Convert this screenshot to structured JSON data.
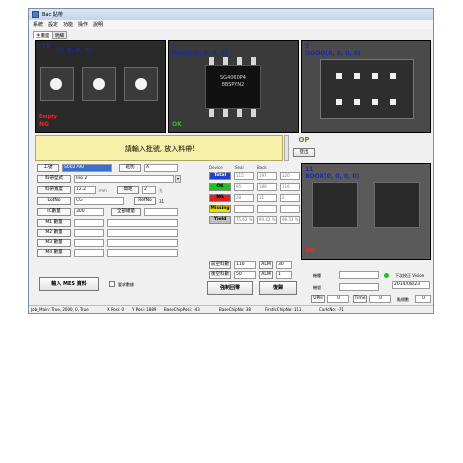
{
  "window": {
    "title": "Bac 貼帶"
  },
  "menu": [
    "系統",
    "設定",
    "功能",
    "操作",
    "說明"
  ],
  "tabs": [
    "主畫面",
    "明細"
  ],
  "cameras": [
    {
      "label": "-11",
      "coords": "(0, 0, 0, 0)",
      "status_top": "Empty",
      "status_bottom": "NG",
      "status_color": "#ff2020"
    },
    {
      "label": "5",
      "coords": "OOOO(0, 0, 0, 0)",
      "status_bottom": "OK",
      "status_color": "#20c020",
      "chip_text": "SG4060P4 8BSPYN2"
    },
    {
      "label": "3",
      "coords": "OOOO(0, 0, 0, 0)"
    },
    {
      "label": "11",
      "coords": "XOOX(0, 0, 0, 0)",
      "status_bottom": "NG",
      "status_color": "#ff2020"
    }
  ],
  "message": "請輸入批號, 放入料帶!",
  "op": {
    "title": "OP",
    "button": "登出"
  },
  "form": {
    "work_order_label": "工號",
    "work_order_value": "S002790",
    "station_label": "班別",
    "station_value": "A",
    "tape_type_label": "料帶型式",
    "tape_type_value": "Ino 2",
    "tape_width_label": "料帶寬度",
    "tape_width_value": "12.2",
    "tape_width_unit": "mm",
    "pitch_label": "間距",
    "pitch_value": "2",
    "pitch_unit": "孔",
    "lotno_label": "LotNo",
    "lotno_value": "CG",
    "refno_label": "RefNo",
    "refno_value": "31",
    "ic_qty_label": "IC數量",
    "ic_qty_value": "300",
    "set_label": "全部總量",
    "m_labels": [
      "M1 數量",
      "M2 數量",
      "M3 數量",
      "M4 數量"
    ]
  },
  "stats": {
    "headers": [
      "Device",
      "Seal",
      "Back"
    ],
    "rows": [
      {
        "label": "Total",
        "color": "#2040d0",
        "text_color": "#ffffff",
        "values": [
          "115",
          "197",
          "120"
        ]
      },
      {
        "label": "OK",
        "color": "#20c020",
        "text_color": "#000000",
        "values": [
          "95",
          "186",
          "116"
        ]
      },
      {
        "label": "NG",
        "color": "#e02020",
        "text_color": "#000000",
        "values": [
          "28",
          "11",
          "2"
        ]
      },
      {
        "label": "Missing",
        "color": "#e8e000",
        "text_color": "#000000",
        "values": [
          "",
          "",
          ""
        ]
      },
      {
        "label": "Yield",
        "color": "#c0c0c0",
        "text_color": "#000000",
        "values": [
          "75.63 %",
          "94.42 %",
          "98.33 %"
        ]
      }
    ]
  },
  "counters": {
    "front_label": "前空料數",
    "front_value": "110",
    "front_alm": "ALM",
    "front_alm_value": "30",
    "back_label": "後空料數",
    "back_value": "50",
    "back_alm": "ALM",
    "back_alm_value": "1"
  },
  "right_panel": {
    "label1": "機種",
    "label2": "機號",
    "next_calib_label": "下次校正 Vision",
    "next_calib_value": "2014/08/23",
    "uph_label": "UPH",
    "uph_value": "0",
    "time_label": "Time",
    "time_value": "0",
    "count_label": "點標數",
    "count_value": "0"
  },
  "buttons": {
    "input_mes": "輸入 MES 資料",
    "checkbox_label": "要求數據",
    "force_reset": "強制回零",
    "reset": "復歸"
  },
  "status_bar": [
    "Job_Main: True, 2000, 0, True",
    "X Posi: 0",
    "Y Posi: 1889",
    "BaseChipPosi: -43",
    "BaseChipNo: 38",
    "FirstIcChipNo: 111",
    "CurIcNo: -71"
  ],
  "colors": {
    "accent_message_bg": "#f6f0a8",
    "ok": "#20c020",
    "ng": "#ff2020",
    "label_blue": "#1a2aa8"
  }
}
